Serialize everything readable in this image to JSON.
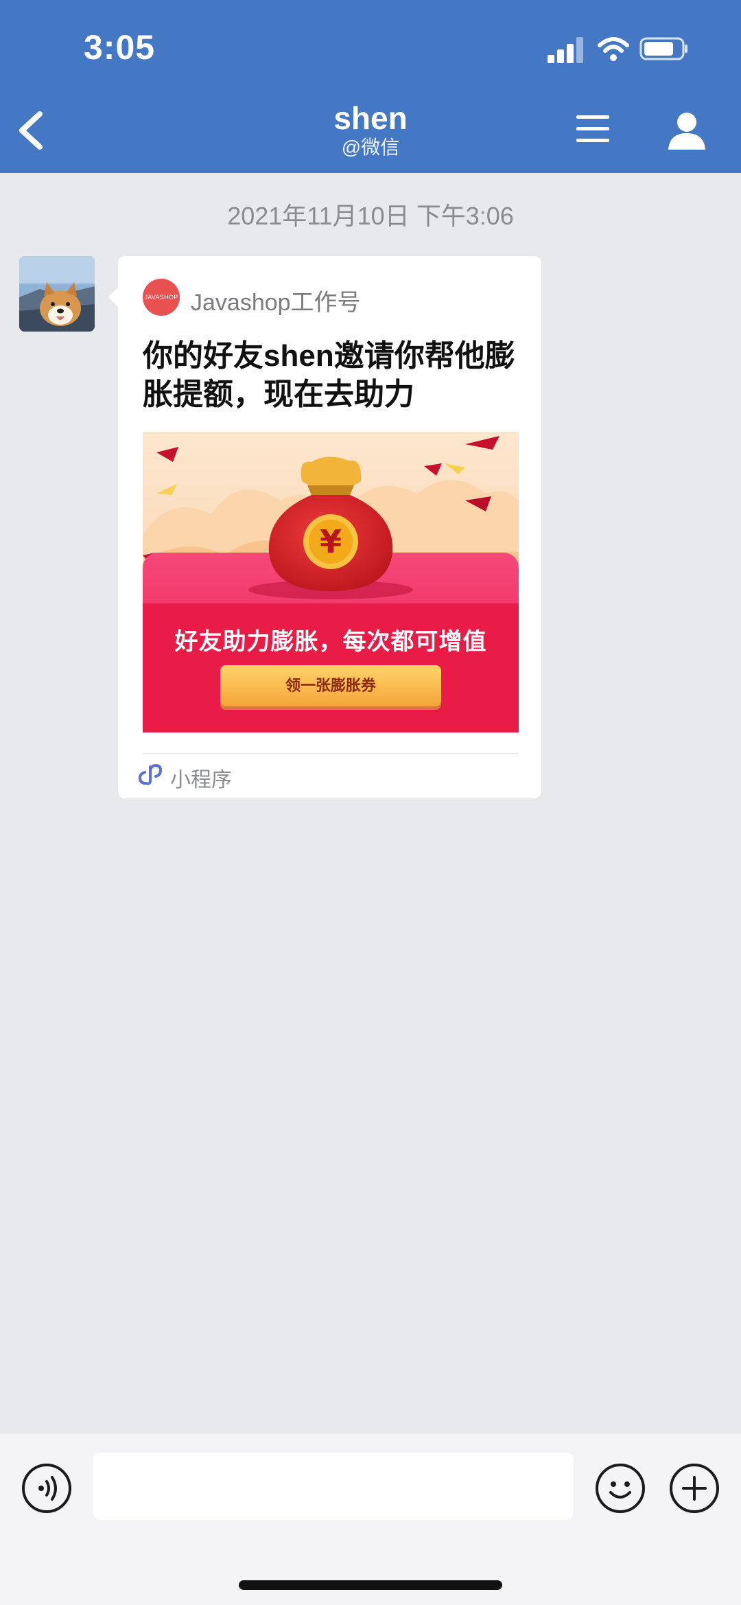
{
  "status_bar": {
    "time": "3:05"
  },
  "header": {
    "title": "shen",
    "subtitle": "@微信",
    "background_color": "#4478c4"
  },
  "chat": {
    "timestamp": "2021年11月10日 下午3:06",
    "message": {
      "source_logo_text": "JAVASHOP",
      "source_name": "Javashop工作号",
      "title": "你的好友shen邀请你帮他膨胀提额，现在去助力",
      "cover_caption": "好友助力膨胀，每次都可增值",
      "cover_button": "领一张膨胀券",
      "footer_label": "小程序"
    }
  },
  "input_bar": {
    "placeholder": "",
    "icons": [
      "voice-icon",
      "emoji-icon",
      "plus-icon"
    ]
  }
}
